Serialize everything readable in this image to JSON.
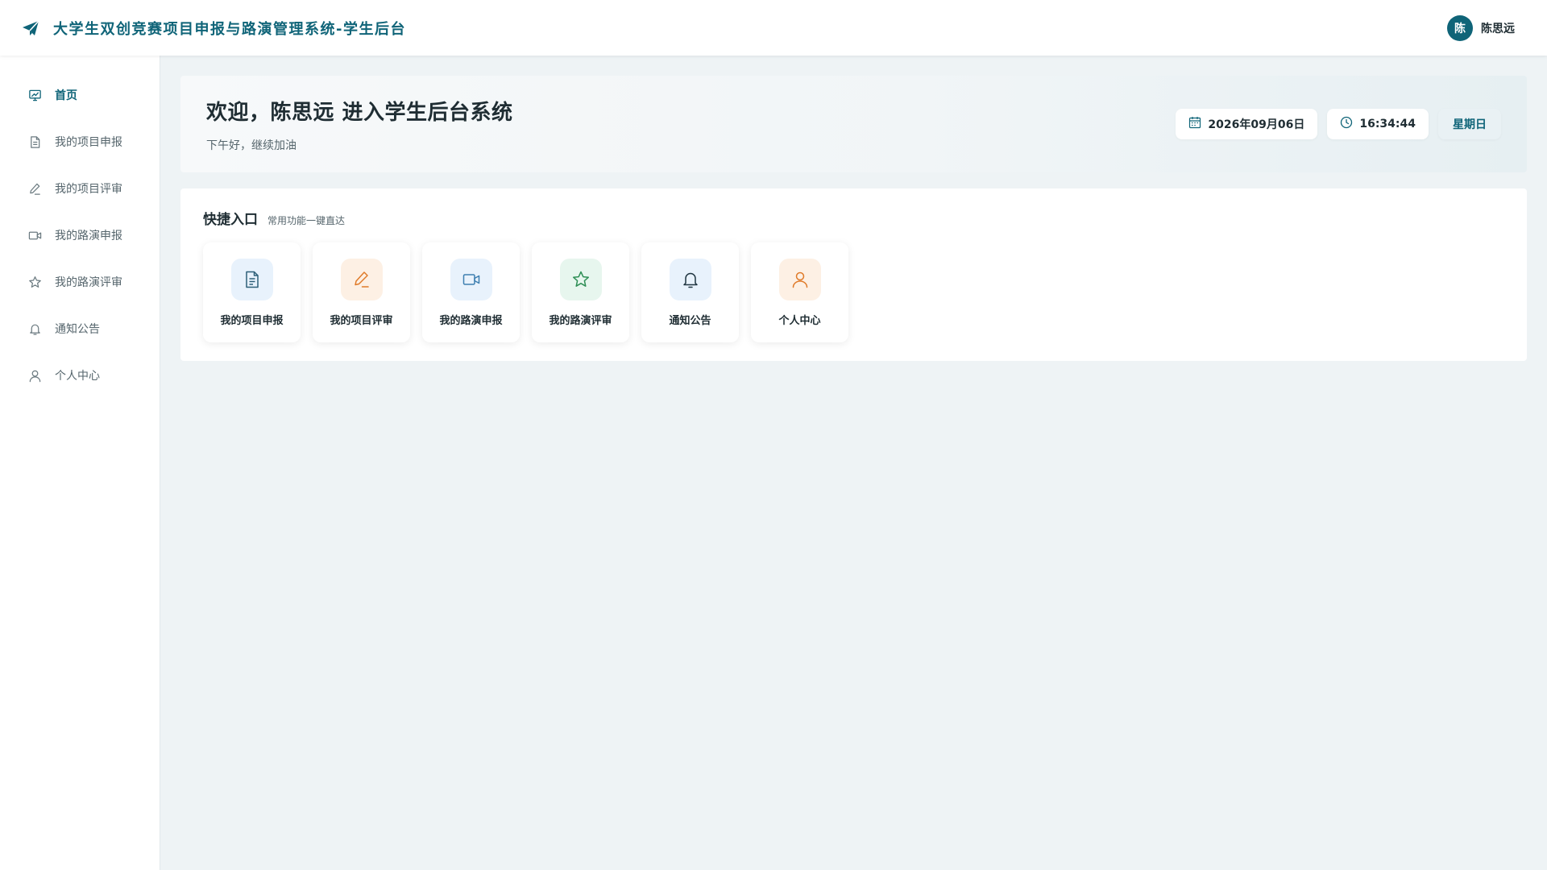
{
  "header": {
    "app_title": "大学生双创竞赛项目申报与路演管理系统-学生后台",
    "brand_icon": "paper-plane-icon",
    "user": {
      "avatar_text": "陈",
      "name": "陈思远"
    }
  },
  "sidebar": {
    "items": [
      {
        "label": "首页",
        "icon": "dashboard-chart-icon",
        "active": true
      },
      {
        "label": "我的项目申报",
        "icon": "document-icon"
      },
      {
        "label": "我的项目评审",
        "icon": "pen-icon"
      },
      {
        "label": "我的路演申报",
        "icon": "video-camera-icon"
      },
      {
        "label": "我的路演评审",
        "icon": "star-icon"
      },
      {
        "label": "通知公告",
        "icon": "bell-icon"
      },
      {
        "label": "个人中心",
        "icon": "user-icon"
      }
    ]
  },
  "welcome": {
    "title": "欢迎，陈思远 进入学生后台系统",
    "subtitle": "下午好，继续加油",
    "date": "2026年09月06日",
    "time": "16:34:44",
    "weekday": "星期日"
  },
  "quick_access": {
    "title": "快捷入口",
    "subtitle": "常用功能一键直达",
    "cards": [
      {
        "label": "我的项目申报",
        "icon": "document-icon",
        "tone": "blue"
      },
      {
        "label": "我的项目评审",
        "icon": "pen-icon",
        "tone": "orange"
      },
      {
        "label": "我的路演申报",
        "icon": "video-camera-icon",
        "tone": "blue"
      },
      {
        "label": "我的路演评审",
        "icon": "star-icon",
        "tone": "green"
      },
      {
        "label": "通知公告",
        "icon": "bell-icon",
        "tone": "blue"
      },
      {
        "label": "个人中心",
        "icon": "user-icon",
        "tone": "orange"
      }
    ]
  },
  "colors": {
    "primary": "#0f6478",
    "page_background": "#eef3f5",
    "icon_blue": "#3d6f87",
    "icon_orange": "#e07b2a",
    "icon_green": "#2f8f56"
  }
}
